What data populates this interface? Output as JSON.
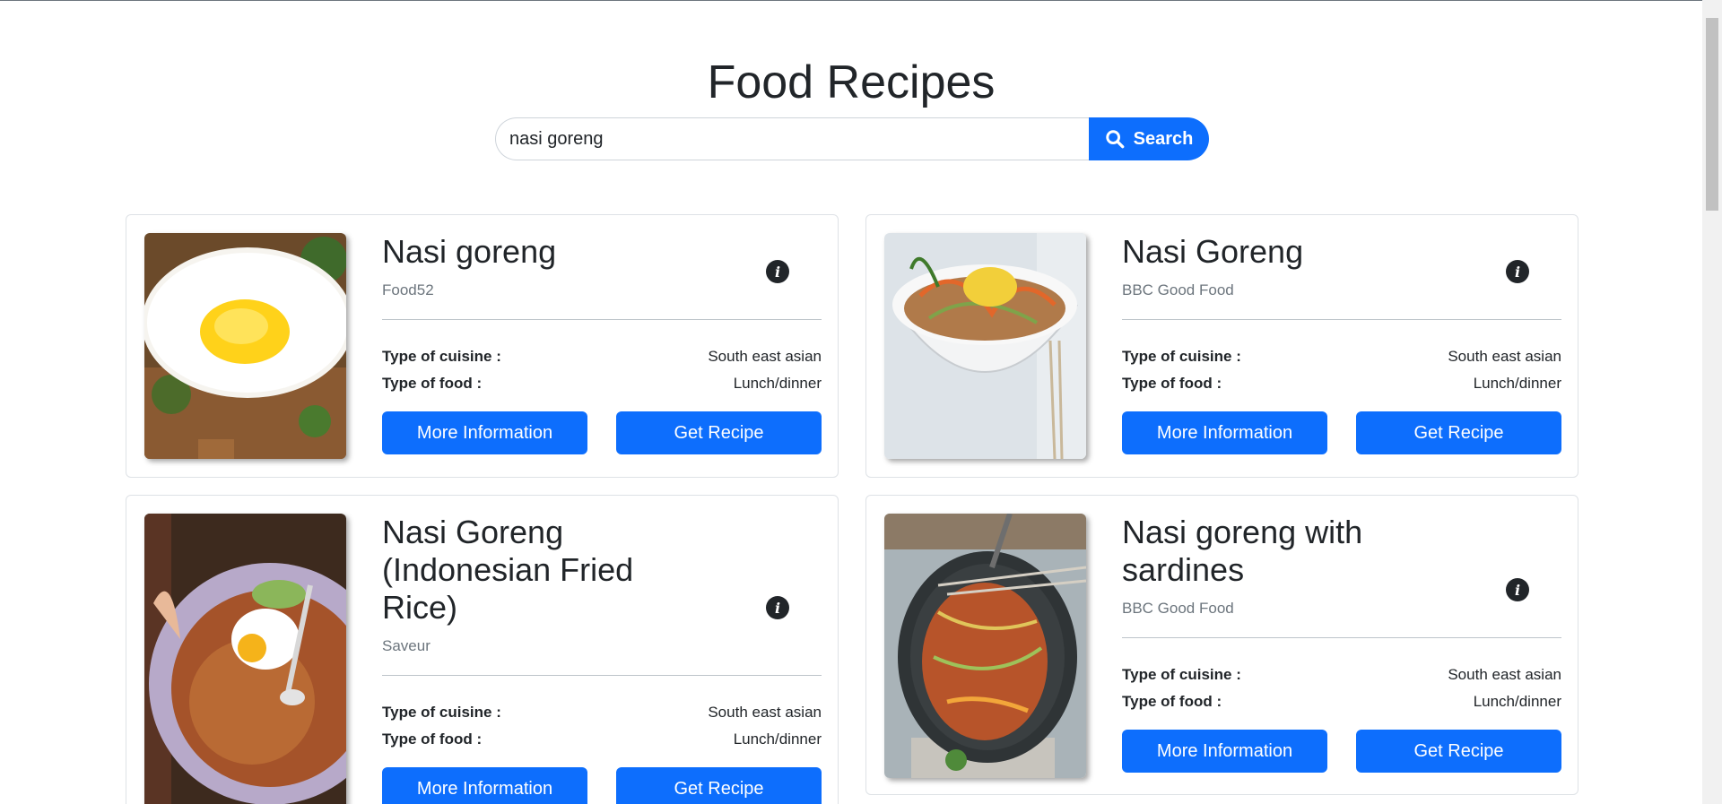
{
  "page": {
    "title": "Food Recipes"
  },
  "search": {
    "value": "nasi goreng",
    "button_label": "Search",
    "icon": "search-icon"
  },
  "labels": {
    "cuisine": "Type of cuisine :",
    "food": "Type of food :",
    "more_info": "More Information",
    "get_recipe": "Get Recipe"
  },
  "recipes": [
    {
      "title": "Nasi goreng",
      "source": "Food52",
      "cuisine": "South east asian",
      "food": "Lunch/dinner",
      "image": "fried-egg-rice-photo"
    },
    {
      "title": "Nasi Goreng",
      "source": "BBC Good Food",
      "cuisine": "South east asian",
      "food": "Lunch/dinner",
      "image": "noodle-bowl-photo"
    },
    {
      "title": "Nasi Goreng (Indonesian Fried Rice)",
      "source": "Saveur",
      "cuisine": "South east asian",
      "food": "Lunch/dinner",
      "image": "plate-fried-rice-photo"
    },
    {
      "title": "Nasi goreng with sardines",
      "source": "BBC Good Food",
      "cuisine": "South east asian",
      "food": "Lunch/dinner",
      "image": "wok-fried-rice-photo"
    }
  ],
  "colors": {
    "primary": "#0d6efd",
    "text": "#212529",
    "muted": "#6c757d"
  }
}
